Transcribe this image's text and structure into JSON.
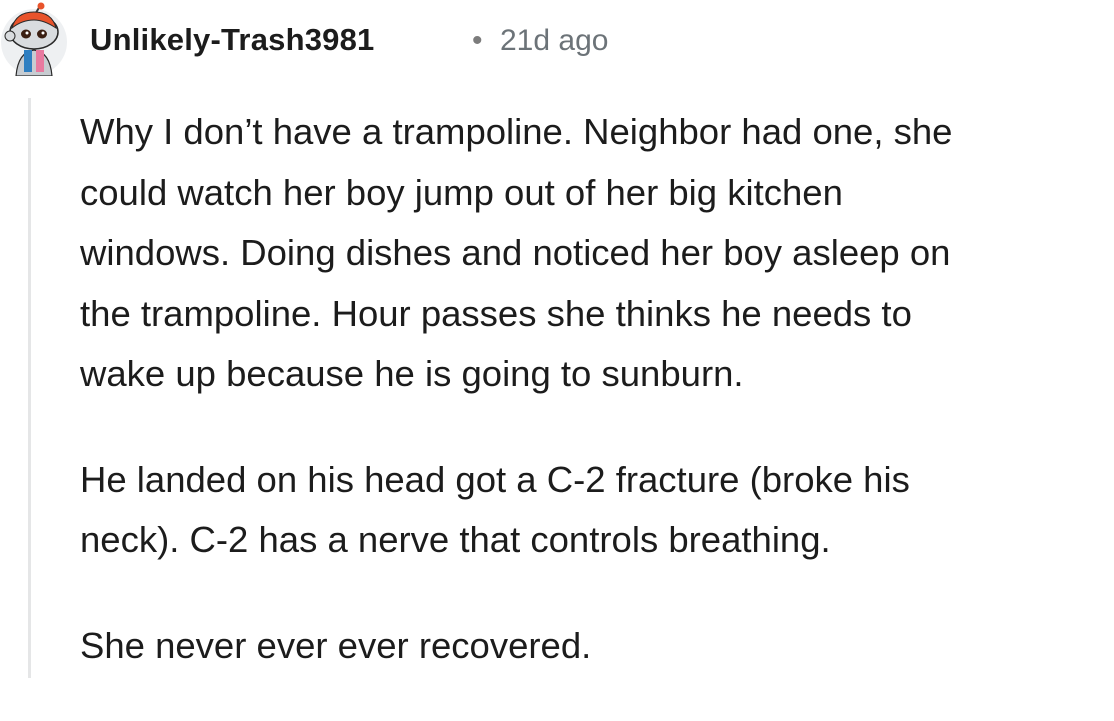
{
  "comment": {
    "author": {
      "username": "Unlikely-Trash3981",
      "avatar_icon": "snoo-avatar-icon"
    },
    "separator": "•",
    "timestamp": "21d ago",
    "paragraphs": [
      {
        "lines": [
          "Why I don’t have a trampoline. Neighbor had one, she",
          "could watch her boy jump out of her big kitchen",
          "windows. Doing dishes and noticed her boy asleep on",
          "the trampoline. Hour passes she thinks he needs to",
          "wake up because he is going to sunburn."
        ]
      },
      {
        "lines": [
          "He landed on his head got a C-2 fracture (broke his",
          "neck). C-2 has a nerve that controls breathing."
        ]
      },
      {
        "lines": [
          "She never ever ever recovered."
        ]
      }
    ]
  },
  "colors": {
    "text": "#1c1c1c",
    "meta": "#6c7378",
    "thread_line": "#e5e6e7",
    "avatar_accent": "#e8532b"
  }
}
